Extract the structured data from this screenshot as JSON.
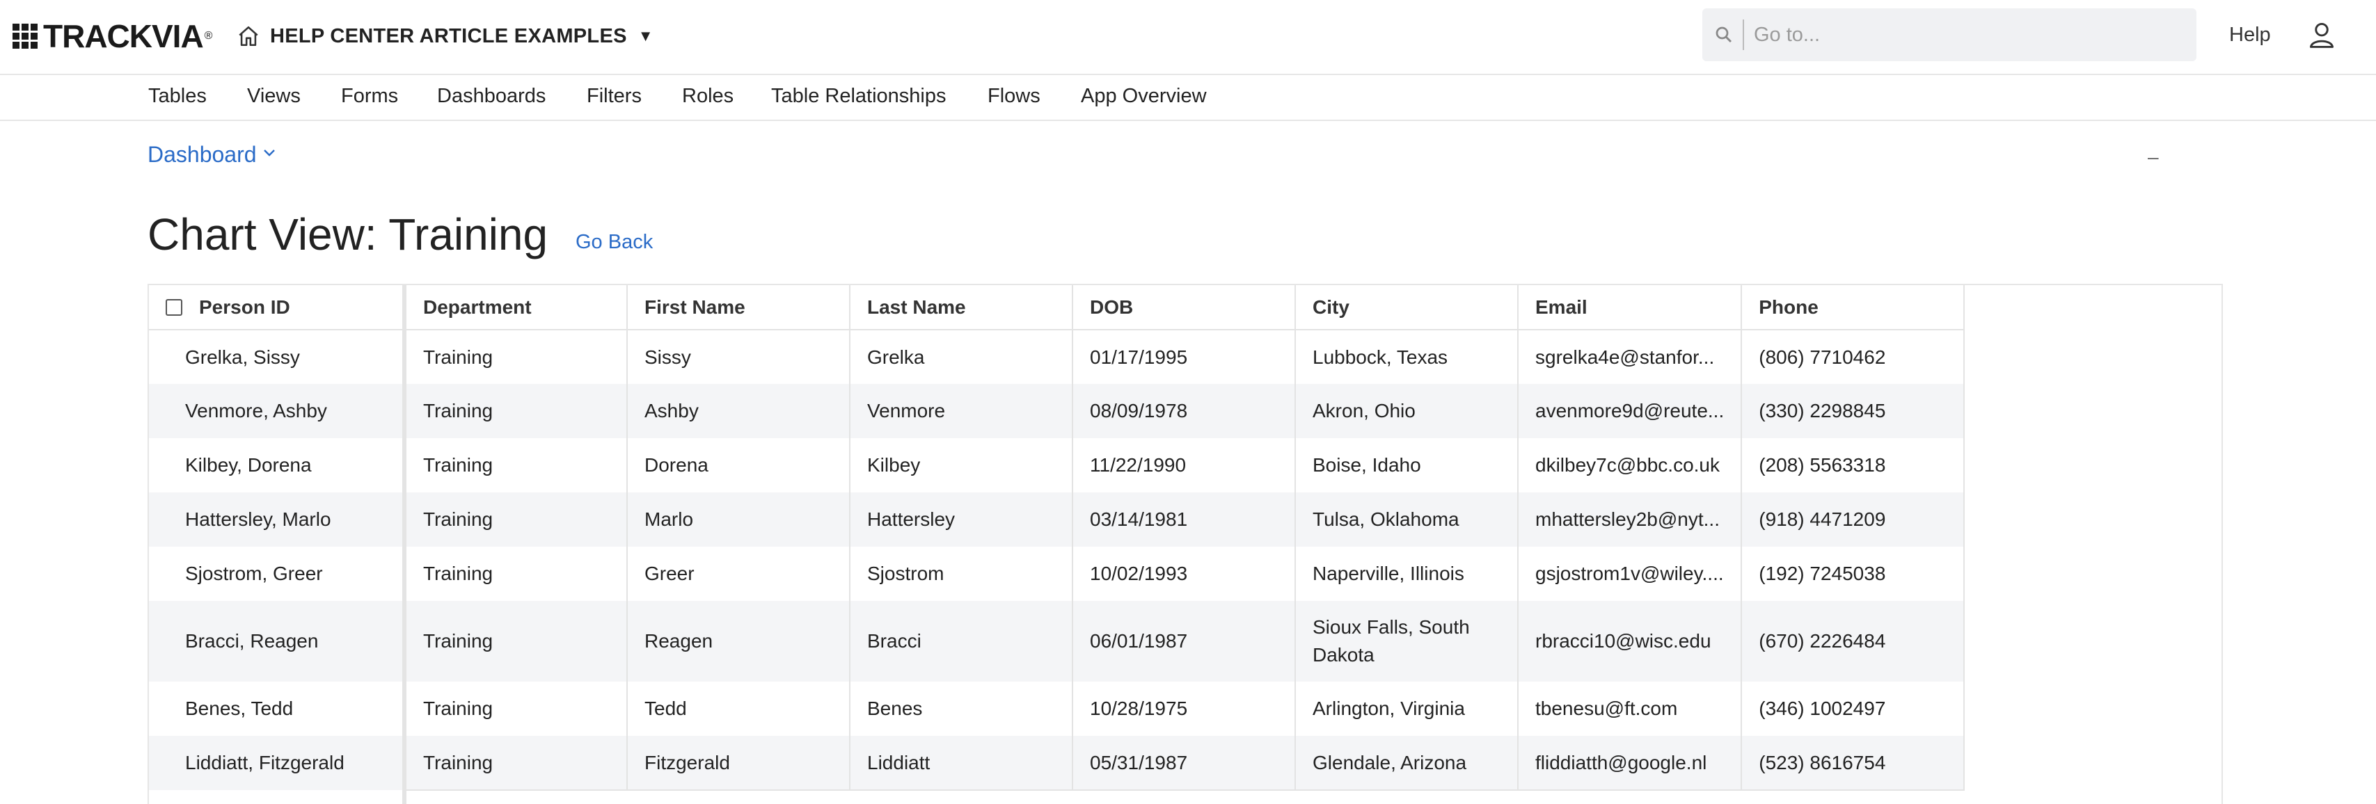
{
  "brand": {
    "name": "TRACKVIA",
    "mark": "®"
  },
  "app": {
    "name": "HELP CENTER ARTICLE EXAMPLES"
  },
  "search": {
    "placeholder": "Go to..."
  },
  "header": {
    "help_label": "Help"
  },
  "nav": {
    "items": [
      "Tables",
      "Views",
      "Forms",
      "Dashboards",
      "Filters",
      "Roles",
      "Table Relationships",
      "Flows",
      "App Overview"
    ]
  },
  "breadcrumb": {
    "dashboard_label": "Dashboard",
    "minimize_label": "–"
  },
  "page": {
    "title": "Chart View: Training",
    "go_back_label": "Go Back"
  },
  "table": {
    "columns": [
      "Person ID",
      "Department",
      "First Name",
      "Last Name",
      "DOB",
      "City",
      "Email",
      "Phone"
    ],
    "rows": [
      {
        "person_id": "Grelka, Sissy",
        "department": "Training",
        "first": "Sissy",
        "last": "Grelka",
        "dob": "01/17/1995",
        "city": "Lubbock, Texas",
        "email": "sgrelka4e@stanfor...",
        "phone": "(806) 7710462"
      },
      {
        "person_id": "Venmore, Ashby",
        "department": "Training",
        "first": "Ashby",
        "last": "Venmore",
        "dob": "08/09/1978",
        "city": "Akron, Ohio",
        "email": "avenmore9d@reute...",
        "phone": "(330) 2298845"
      },
      {
        "person_id": "Kilbey, Dorena",
        "department": "Training",
        "first": "Dorena",
        "last": "Kilbey",
        "dob": "11/22/1990",
        "city": "Boise, Idaho",
        "email": "dkilbey7c@bbc.co.uk",
        "phone": "(208) 5563318"
      },
      {
        "person_id": "Hattersley, Marlo",
        "department": "Training",
        "first": "Marlo",
        "last": "Hattersley",
        "dob": "03/14/1981",
        "city": "Tulsa, Oklahoma",
        "email": "mhattersley2b@nyt...",
        "phone": "(918) 4471209"
      },
      {
        "person_id": "Sjostrom, Greer",
        "department": "Training",
        "first": "Greer",
        "last": "Sjostrom",
        "dob": "10/02/1993",
        "city": "Naperville, Illinois",
        "email": "gsjostrom1v@wiley....",
        "phone": "(192) 7245038"
      },
      {
        "person_id": "Bracci, Reagen",
        "department": "Training",
        "first": "Reagen",
        "last": "Bracci",
        "dob": "06/01/1987",
        "city": "Sioux Falls, South Dakota",
        "email": "rbracci10@wisc.edu",
        "phone": "(670) 2226484"
      },
      {
        "person_id": "Benes, Tedd",
        "department": "Training",
        "first": "Tedd",
        "last": "Benes",
        "dob": "10/28/1975",
        "city": "Arlington, Virginia",
        "email": "tbenesu@ft.com",
        "phone": "(346) 1002497"
      },
      {
        "person_id": "Liddiatt, Fitzgerald",
        "department": "Training",
        "first": "Fitzgerald",
        "last": "Liddiatt",
        "dob": "05/31/1987",
        "city": "Glendale, Arizona",
        "email": "fliddiatth@google.nl",
        "phone": "(523) 8616754"
      }
    ]
  },
  "colors": {
    "link": "#2a6bc7",
    "row_alt": "#f4f5f7",
    "border": "#e3e3e3"
  }
}
